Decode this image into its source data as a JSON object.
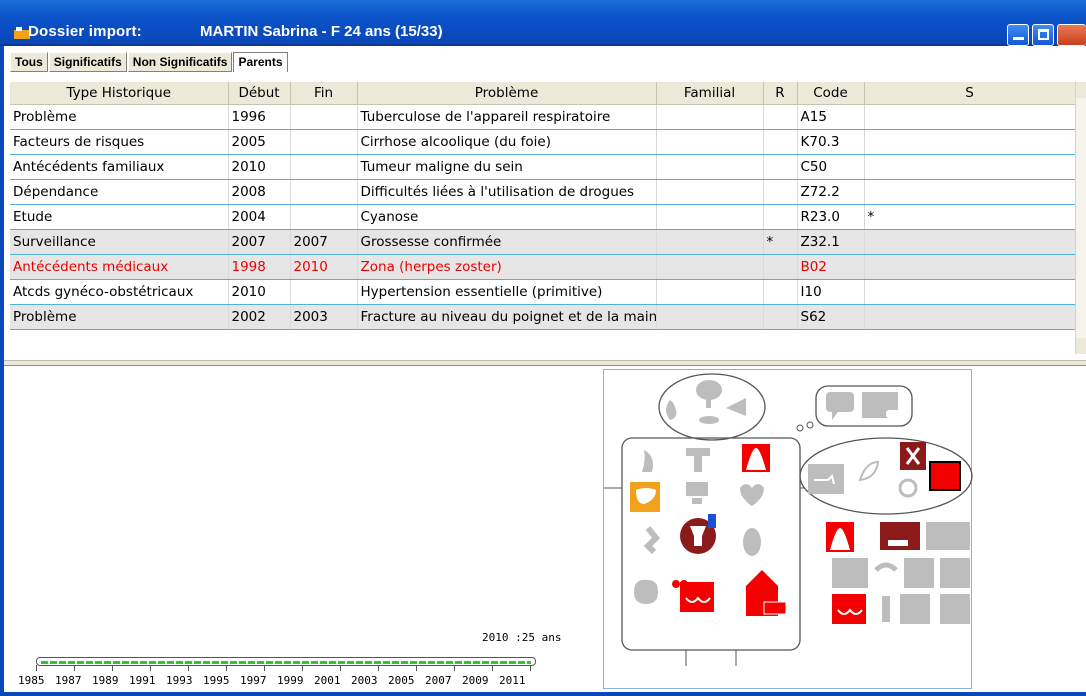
{
  "window": {
    "title_prefix": "Dossier import:",
    "title_patient": "MARTIN Sabrina - F 24 ans (15/33)"
  },
  "tabs": [
    {
      "label": "Tous"
    },
    {
      "label": "Significatifs"
    },
    {
      "label": "Non Significatifs"
    },
    {
      "label": "Parents"
    }
  ],
  "table": {
    "columns": [
      "Type Historique",
      "Début",
      "Fin",
      "Problème",
      "Familial",
      "R",
      "Code",
      "S"
    ],
    "rows": [
      {
        "type": "Problème",
        "debut": "1996",
        "fin": "",
        "probleme": "Tuberculose de l'appareil respiratoire",
        "familial": "",
        "r": "",
        "code": "A15",
        "s": ""
      },
      {
        "type": "Facteurs de risques",
        "debut": "2005",
        "fin": "",
        "probleme": "Cirrhose alcoolique (du foie)",
        "familial": "",
        "r": "",
        "code": "K70.3",
        "s": ""
      },
      {
        "type": "Antécédents familiaux",
        "debut": "2010",
        "fin": "",
        "probleme": "Tumeur maligne du sein",
        "familial": "",
        "r": "",
        "code": "C50",
        "s": ""
      },
      {
        "type": "Dépendance",
        "debut": "2008",
        "fin": "",
        "probleme": "Difficultés liées à l'utilisation de drogues",
        "familial": "",
        "r": "",
        "code": "Z72.2",
        "s": ""
      },
      {
        "type": "Etude",
        "debut": "2004",
        "fin": "",
        "probleme": "Cyanose",
        "familial": "",
        "r": "",
        "code": "R23.0",
        "s": "*"
      },
      {
        "type": "Surveillance",
        "debut": "2007",
        "fin": "2007",
        "probleme": "Grossesse confirmée",
        "familial": "",
        "r": "*",
        "code": "Z32.1",
        "s": ""
      },
      {
        "type": "Antécédents médicaux",
        "debut": "1998",
        "fin": "2010",
        "probleme": "Zona (herpes zoster)",
        "familial": "",
        "r": "",
        "code": "B02",
        "s": ""
      },
      {
        "type": "Atcds gynéco-obstétricaux",
        "debut": "2010",
        "fin": "",
        "probleme": "Hypertension essentielle (primitive)",
        "familial": "",
        "r": "",
        "code": "I10",
        "s": ""
      },
      {
        "type": "Problème",
        "debut": "2002",
        "fin": "2003",
        "probleme": "Fracture au niveau du poignet et de la main",
        "familial": "",
        "r": "",
        "code": "S62",
        "s": ""
      }
    ]
  },
  "timeline": {
    "label": "2010 :25 ans",
    "years": [
      "1985",
      "1987",
      "1989",
      "1991",
      "1993",
      "1995",
      "1997",
      "1999",
      "2001",
      "2003",
      "2005",
      "2007",
      "2009",
      "2011"
    ]
  },
  "colors": {
    "titlebar": "#0b52c8",
    "accent_red": "#f50000",
    "dark_red": "#8b1a1a",
    "grey_icon": "#bdbdbd",
    "orange": "#f2a11a",
    "timeline_green": "#2ec72e"
  },
  "body_map_icons": [
    "ear-icon",
    "brain-icon",
    "mouth-icon",
    "eye-icon",
    "speech-bubble-icon",
    "monitor-icon",
    "throat-icon",
    "skin-icon",
    "liver-icon",
    "thyroid-icon",
    "heart-icon",
    "stomach-icon",
    "uterus-icon",
    "kidney-icon",
    "intestine-icon",
    "breast-icon",
    "house-icon",
    "lungs-icon",
    "bone-icon",
    "vessel-icon",
    "joint-icon"
  ]
}
